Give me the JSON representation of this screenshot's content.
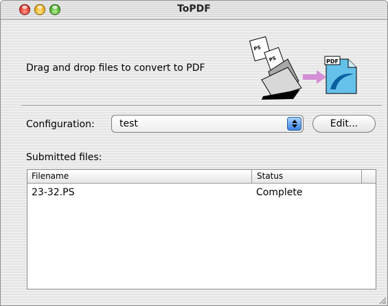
{
  "window": {
    "title": "ToPDF"
  },
  "drop_area": {
    "instruction": "Drag and drop files to convert to PDF",
    "pdf_badge": "PDF"
  },
  "configuration": {
    "label": "Configuration:",
    "selected": "test",
    "edit_label": "Edit..."
  },
  "files": {
    "label": "Submitted files:",
    "columns": [
      "Filename",
      "Status"
    ],
    "rows": [
      {
        "filename": "23-32.PS",
        "status": "Complete"
      }
    ]
  },
  "colors": {
    "arrow": "#d48fd6",
    "pdf_page": "#64c1ea",
    "popup_arrows": "#3a83e1"
  }
}
